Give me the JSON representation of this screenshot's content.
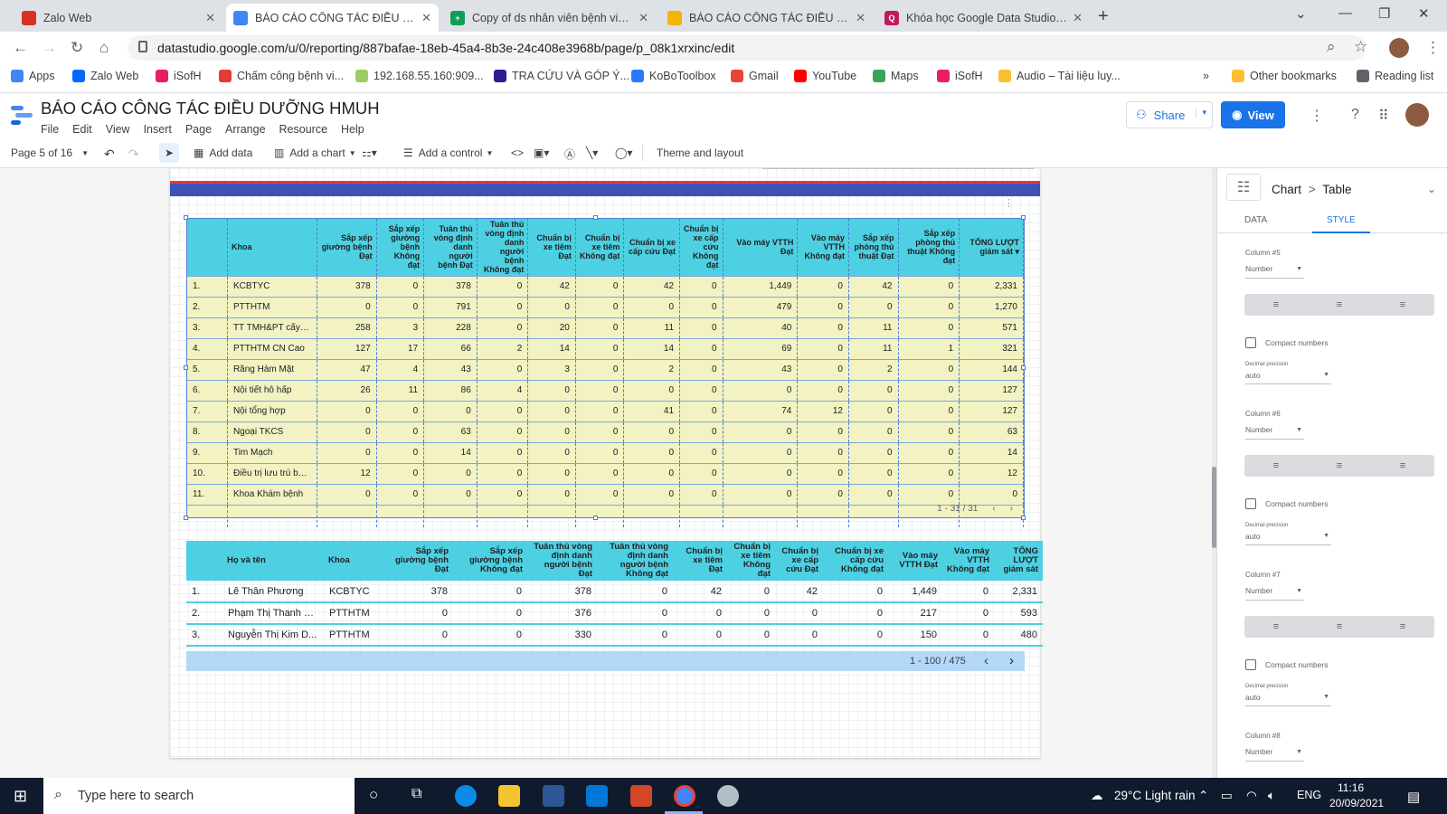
{
  "browser": {
    "tabs": [
      {
        "title": "Zalo Web",
        "color": "#d93025",
        "glyph": "Zalo"
      },
      {
        "title": "BÁO CÁO CÔNG TÁC ĐIỀU DƯỠNG HMUH",
        "color": "#4285f4",
        "glyph": ""
      },
      {
        "title": "Copy of ds nhân viên bệnh viện 2021",
        "color": "#0f9d58",
        "glyph": "+"
      },
      {
        "title": "BÁO CÁO CÔNG TÁC ĐIỀU DƯỠNG HMUH",
        "color": "#f4b400",
        "glyph": ""
      },
      {
        "title": "Khóa học Google Data Studio chuyên sâu",
        "color": "#c2185b",
        "glyph": "Q"
      }
    ],
    "url": "datastudio.google.com/u/0/reporting/887bafae-18eb-45a4-8b3e-24c408e3968b/page/p_08k1xrxinc/edit",
    "bookmarks": [
      "Apps",
      "Zalo Web",
      "iSofH",
      "Chấm công bệnh vi...",
      "192.168.55.160:909...",
      "TRA CỨU VÀ GÓP Ý...",
      "KoBoToolbox",
      "Gmail",
      "YouTube",
      "Maps",
      "iSofH",
      "Audio – Tài liệu luy..."
    ],
    "other_bookmarks": "Other bookmarks",
    "reading_list": "Reading list",
    "more": "»"
  },
  "app": {
    "title": "BÁO CÁO CÔNG TÁC ĐIỀU DƯỠNG HMUH",
    "menu": [
      "File",
      "Edit",
      "View",
      "Insert",
      "Page",
      "Arrange",
      "Resource",
      "Help"
    ],
    "share": "Share",
    "view": "View"
  },
  "toolbar": {
    "page": "Page 5 of 16",
    "add_data": "Add data",
    "add_chart": "Add a chart",
    "add_control": "Add a control",
    "theme": "Theme and layout"
  },
  "table1": {
    "headers": [
      "",
      "Khoa",
      "Sắp xếp giường bệnh Đạt",
      "Sắp xếp giường bệnh Không đạt",
      "Tuân thủ vòng định danh người bệnh Đạt",
      "Tuân thủ vòng định danh người bệnh Không đạt",
      "Chuẩn bị xe tiêm Đạt",
      "Chuẩn bị xe tiêm Không đạt",
      "Chuẩn bị xe cấp cứu Đạt",
      "Chuẩn bị xe cấp cứu Không đạt",
      "Vào máy VTTH Đạt",
      "Vào máy VTTH Không đạt",
      "Sắp xếp phòng thủ thuật Đạt",
      "Sắp xếp phòng thủ thuật Không đạt",
      "TỔNG LƯỢT giám sát ▾"
    ],
    "rows": [
      [
        "1.",
        "KCBTYC",
        "378",
        "0",
        "378",
        "0",
        "42",
        "0",
        "42",
        "0",
        "1,449",
        "0",
        "42",
        "0",
        "2,331"
      ],
      [
        "2.",
        "PTTHTM",
        "0",
        "0",
        "791",
        "0",
        "0",
        "0",
        "0",
        "0",
        "479",
        "0",
        "0",
        "0",
        "1,270"
      ],
      [
        "3.",
        "TT TMH&PT cấy ố...",
        "258",
        "3",
        "228",
        "0",
        "20",
        "0",
        "11",
        "0",
        "40",
        "0",
        "11",
        "0",
        "571"
      ],
      [
        "4.",
        "PTTHTM CN Cao",
        "127",
        "17",
        "66",
        "2",
        "14",
        "0",
        "14",
        "0",
        "69",
        "0",
        "11",
        "1",
        "321"
      ],
      [
        "5.",
        "Răng Hàm Mặt",
        "47",
        "4",
        "43",
        "0",
        "3",
        "0",
        "2",
        "0",
        "43",
        "0",
        "2",
        "0",
        "144"
      ],
      [
        "6.",
        "Nội tiết hô hấp",
        "26",
        "11",
        "86",
        "4",
        "0",
        "0",
        "0",
        "0",
        "0",
        "0",
        "0",
        "0",
        "127"
      ],
      [
        "7.",
        "Nội tổng hợp",
        "0",
        "0",
        "0",
        "0",
        "0",
        "0",
        "41",
        "0",
        "74",
        "12",
        "0",
        "0",
        "127"
      ],
      [
        "8.",
        "Ngoại TKCS",
        "0",
        "0",
        "63",
        "0",
        "0",
        "0",
        "0",
        "0",
        "0",
        "0",
        "0",
        "0",
        "63"
      ],
      [
        "9.",
        "Tim Mạch",
        "0",
        "0",
        "14",
        "0",
        "0",
        "0",
        "0",
        "0",
        "0",
        "0",
        "0",
        "0",
        "14"
      ],
      [
        "10.",
        "Điều trị lưu trú ban...",
        "12",
        "0",
        "0",
        "0",
        "0",
        "0",
        "0",
        "0",
        "0",
        "0",
        "0",
        "0",
        "12"
      ],
      [
        "11.",
        "Khoa Khám bệnh",
        "0",
        "0",
        "0",
        "0",
        "0",
        "0",
        "0",
        "0",
        "0",
        "0",
        "0",
        "0",
        "0"
      ]
    ],
    "pager": "1 - 31 / 31"
  },
  "table2": {
    "headers": [
      "",
      "Họ và tên",
      "Khoa",
      "Sắp xếp giường bệnh Đạt",
      "Sắp xếp giường bệnh Không đạt",
      "Tuân thủ vòng định danh người bệnh Đạt",
      "Tuân thủ vòng định danh người bệnh Không đạt",
      "Chuẩn bị xe tiêm Đạt",
      "Chuẩn bị xe tiêm Không đạt",
      "Chuẩn bị xe cấp cứu Đạt",
      "Chuẩn bị xe cấp cứu Không đạt",
      "Vào máy VTTH Đạt",
      "Vào máy VTTH Không đạt",
      "TỔNG LƯỢT giám sát"
    ],
    "rows": [
      [
        "1.",
        "Lê Thân Phương",
        "KCBTYC",
        "378",
        "0",
        "378",
        "0",
        "42",
        "0",
        "42",
        "0",
        "1,449",
        "0",
        "2,331"
      ],
      [
        "2.",
        "Phạm Thị Thanh H...",
        "PTTHTM",
        "0",
        "0",
        "376",
        "0",
        "0",
        "0",
        "0",
        "0",
        "217",
        "0",
        "593"
      ],
      [
        "3.",
        "Nguyễn Thị Kim D...",
        "PTTHTM",
        "0",
        "0",
        "330",
        "0",
        "0",
        "0",
        "0",
        "0",
        "150",
        "0",
        "480"
      ]
    ],
    "pager": "1 - 100 / 475"
  },
  "panel": {
    "chart": "Chart",
    "sep": ">",
    "type": "Table",
    "tab_data": "DATA",
    "tab_style": "STYLE",
    "columns": [
      {
        "label": "Column #5",
        "format": "Number",
        "compact": "Compact numbers",
        "decimal_label": "Decimal precision",
        "decimal": "auto"
      },
      {
        "label": "Column #6",
        "format": "Number",
        "compact": "Compact numbers",
        "decimal_label": "Decimal precision",
        "decimal": "auto"
      },
      {
        "label": "Column #7",
        "format": "Number",
        "compact": "Compact numbers",
        "decimal_label": "Decimal precision",
        "decimal": "auto"
      },
      {
        "label": "Column #8",
        "format": "Number"
      }
    ]
  },
  "taskbar": {
    "search": "Type here to search",
    "weather": "29°C  Light rain",
    "lang": "ENG",
    "time": "11:16",
    "date": "20/09/2021"
  },
  "colors": {
    "table_header": "#4dd0e1",
    "table_body": "#f2f2c2",
    "accent": "#1a73e8",
    "report_band": "#3f51b5",
    "report_line": "#e53935"
  }
}
